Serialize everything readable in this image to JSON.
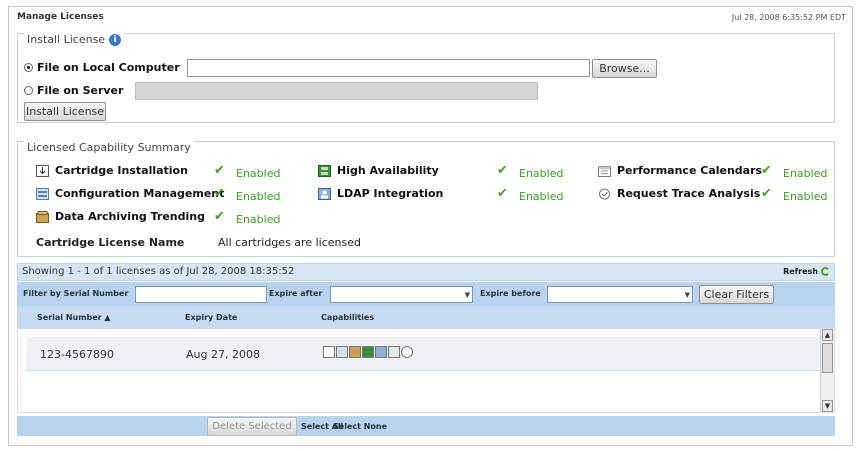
{
  "window": {
    "title": "Manage Licenses",
    "timestamp": "Jul 28, 2008 6:35:52 PM EDT"
  },
  "install_license": {
    "legend": "Install License",
    "option_local": "File on Local Computer",
    "option_server": "File on Server",
    "browse_label": "Browse...",
    "install_label": "Install License",
    "local_value": "",
    "server_value": ""
  },
  "summary": {
    "legend": "Licensed Capability Summary",
    "capabilities": [
      {
        "name": "Cartridge Installation",
        "status": "Enabled",
        "icon": "cartridge-install-icon"
      },
      {
        "name": "Configuration Management",
        "status": "Enabled",
        "icon": "configuration-icon"
      },
      {
        "name": "Data Archiving Trending",
        "status": "Enabled",
        "icon": "archive-icon"
      },
      {
        "name": "High Availability",
        "status": "Enabled",
        "icon": "high-availability-icon"
      },
      {
        "name": "LDAP Integration",
        "status": "Enabled",
        "icon": "ldap-icon"
      },
      {
        "name": "Performance Calendars",
        "status": "Enabled",
        "icon": "calendar-icon"
      },
      {
        "name": "Request Trace Analysis",
        "status": "Enabled",
        "icon": "trace-icon"
      }
    ],
    "cartridge_license_label": "Cartridge License Name",
    "cartridge_license_value": "All cartridges are licensed"
  },
  "grid": {
    "showing": "Showing 1 - 1  of 1 licenses as of Jul 28, 2008 18:35:52",
    "refresh_label": "Refresh",
    "filter_serial_label": "Filter by Serial Number",
    "expire_after_label": "Expire after",
    "expire_before_label": "Expire before",
    "clear_filters_label": "Clear Filters",
    "columns": [
      "Serial Number ▲",
      "Expiry Date",
      "Capabilities"
    ],
    "rows": [
      {
        "serial": "123-4567890",
        "expiry": "Aug 27, 2008"
      }
    ],
    "delete_label": "Delete Selected",
    "select_all_label": "Select All",
    "select_none_label": "Select None"
  },
  "colors": {
    "enabled_green": "#3f9a2a",
    "header_blue": "#b9d3ee",
    "toolbar_blue": "#d7e6f5"
  }
}
